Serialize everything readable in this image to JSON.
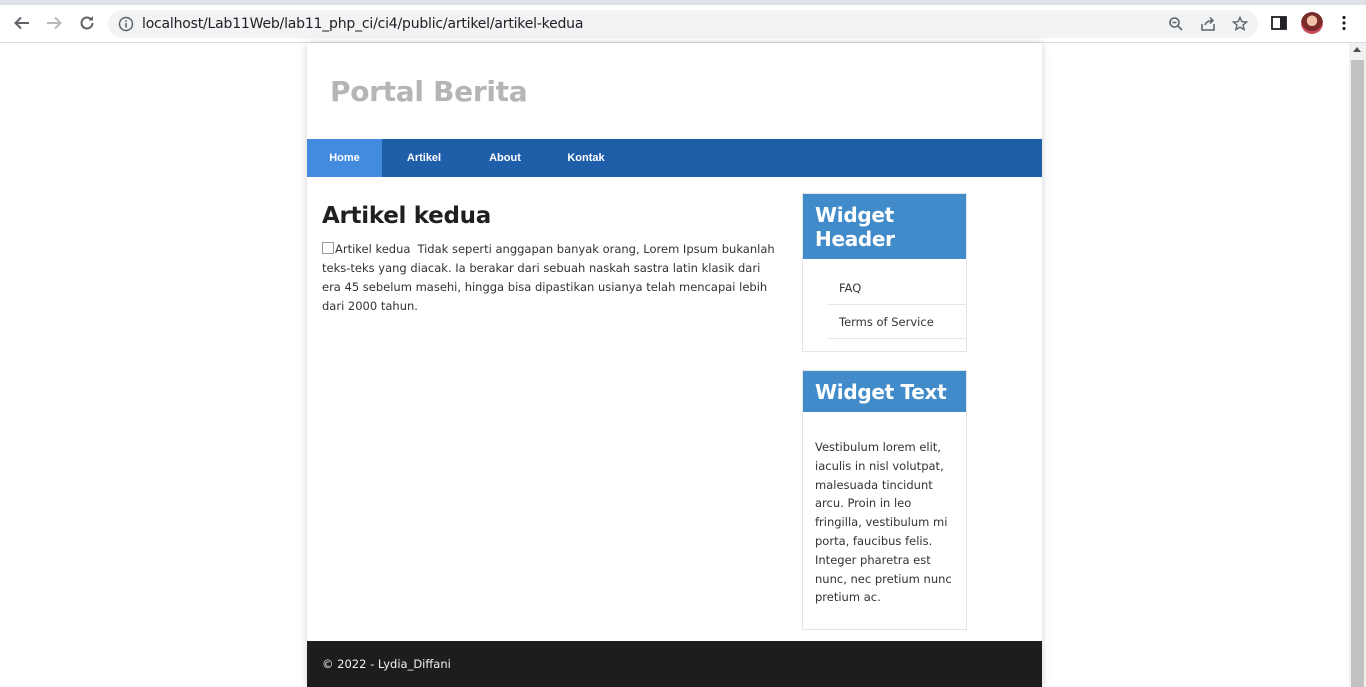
{
  "browser": {
    "url": "localhost/Lab11Web/lab11_php_ci/ci4/public/artikel/artikel-kedua"
  },
  "site": {
    "title": "Portal Berita"
  },
  "nav": {
    "items": [
      {
        "label": "Home",
        "active": true
      },
      {
        "label": "Artikel",
        "active": false
      },
      {
        "label": "About",
        "active": false
      },
      {
        "label": "Kontak",
        "active": false
      }
    ]
  },
  "article": {
    "title": "Artikel kedua",
    "image_alt": "Artikel kedua",
    "body": "Tidak seperti anggapan banyak orang, Lorem Ipsum bukanlah teks-teks yang diacak. Ia berakar dari sebuah naskah sastra latin klasik dari era 45 sebelum masehi, hingga bisa dipastikan usianya telah mencapai lebih dari 2000 tahun."
  },
  "sidebar": {
    "widget_header": {
      "title": "Widget Header",
      "links": [
        "FAQ",
        "Terms of Service"
      ]
    },
    "widget_text": {
      "title": "Widget Text",
      "body": "Vestibulum lorem elit, iaculis in nisl volutpat, malesuada tincidunt arcu. Proin in leo fringilla, vestibulum mi porta, faucibus felis. Integer pharetra est nunc, nec pretium nunc pretium ac."
    }
  },
  "footer": {
    "text": "© 2022 - Lydia_Diffani"
  },
  "colors": {
    "nav_bg": "#1f5faa",
    "nav_active": "#428bde",
    "widget_header_bg": "#428bca",
    "footer_bg": "#1d1d1d",
    "site_title": "#b5b5b5"
  }
}
